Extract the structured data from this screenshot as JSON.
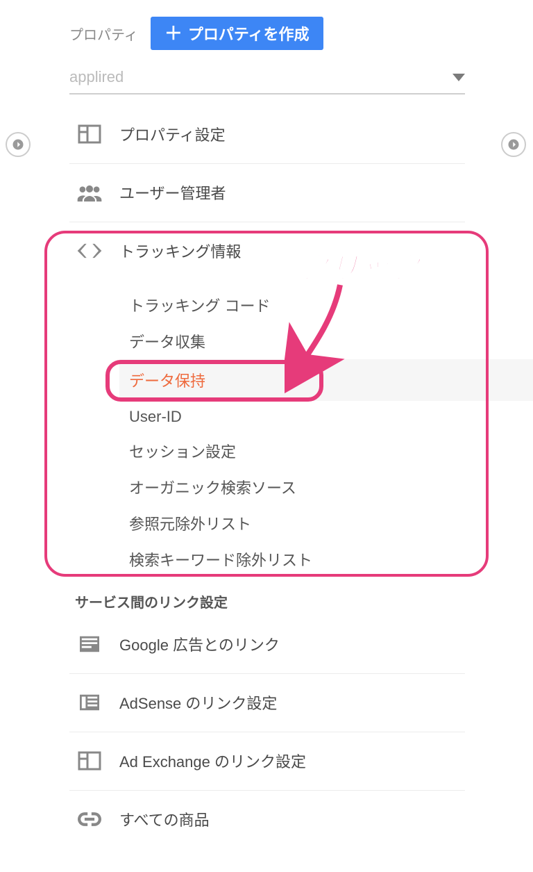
{
  "header": {
    "label": "プロパティ",
    "create_button": "プロパティを作成"
  },
  "property_select": {
    "selected": "applired"
  },
  "menu": {
    "property_settings": "プロパティ設定",
    "user_management": "ユーザー管理者",
    "tracking_info": "トラッキング情報",
    "tracking_submenu": [
      "トラッキング コード",
      "データ収集",
      "データ保持",
      "User-ID",
      "セッション設定",
      "オーガニック検索ソース",
      "参照元除外リスト",
      "検索キーワード除外リスト"
    ],
    "section_heading": "サービス間のリンク設定",
    "google_ads_link": "Google 広告とのリンク",
    "adsense_link": "AdSense のリンク設定",
    "adexchange_link": "Ad Exchange のリンク設定",
    "all_products": "すべての商品"
  },
  "annotation": {
    "label": "クリック"
  }
}
